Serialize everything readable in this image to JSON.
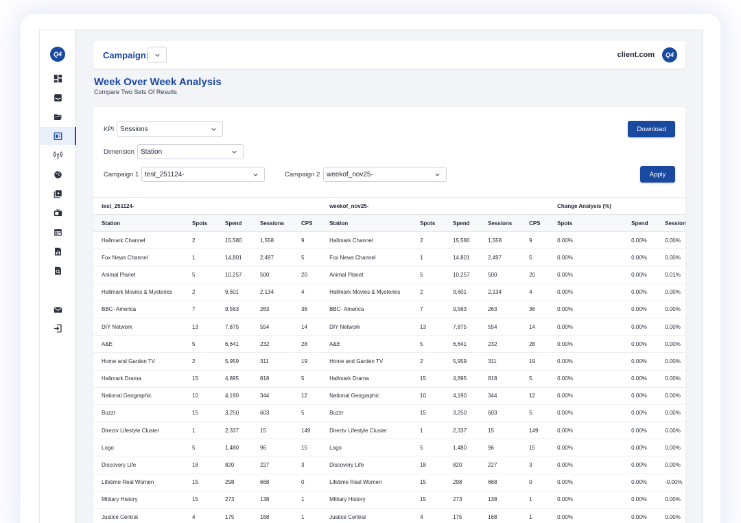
{
  "sidebar": {
    "logo": "Q4",
    "items": [
      {
        "icon": "dashboard-icon"
      },
      {
        "icon": "inbox-icon"
      },
      {
        "icon": "folder-open-icon"
      },
      {
        "icon": "newspaper-icon",
        "active": true
      },
      {
        "icon": "antenna-icon"
      },
      {
        "icon": "globe-icon"
      },
      {
        "icon": "video-library-icon"
      },
      {
        "icon": "tv-icon"
      },
      {
        "icon": "calendar-icon"
      },
      {
        "icon": "report-icon"
      },
      {
        "icon": "search-doc-icon"
      },
      {
        "icon": "mail-icon"
      },
      {
        "icon": "logout-icon"
      }
    ]
  },
  "header": {
    "campaign_label": "Campaign:",
    "client_name": "client.com",
    "client_avatar": "Q4"
  },
  "page": {
    "title": "Week Over Week Analysis",
    "subtitle": "Compare Two Sets Of Results"
  },
  "filters": {
    "kpi_label": "KPI",
    "kpi_value": "Sessions",
    "dimension_label": "Dimension",
    "dimension_value": "Station",
    "campaign1_label": "Campaign 1",
    "campaign1_value": "test_251124-",
    "campaign2_label": "Campaign 2",
    "campaign2_value": "weekof_nov25-",
    "download_label": "Download",
    "apply_label": "Apply"
  },
  "table": {
    "groups": [
      "test_251124-",
      "weekof_nov25-",
      "Change Analysis (%)"
    ],
    "headers": [
      "Station",
      "Spots",
      "Spend",
      "Sessions",
      "CPS",
      "Station",
      "Spots",
      "Spend",
      "Sessions",
      "CPS",
      "Spots",
      "Spend",
      "Sessions"
    ],
    "rows": [
      [
        "Hallmark Channel",
        "2",
        "15,580",
        "1,558",
        "9",
        "Hallmark Channel",
        "2",
        "15,580",
        "1,558",
        "9",
        "0.00%",
        "0.00%",
        "0.00%"
      ],
      [
        "Fox News Channel",
        "1",
        "14,801",
        "2,497",
        "5",
        "Fox News Channel",
        "1",
        "14,801",
        "2,497",
        "5",
        "0.00%",
        "0.00%",
        "0.00%"
      ],
      [
        "Animal Planet",
        "5",
        "10,257",
        "500",
        "20",
        "Animal Planet",
        "5",
        "10,257",
        "500",
        "20",
        "0.00%",
        "0.00%",
        "0.01%"
      ],
      [
        "Hallmark Movies & Mysteries",
        "2",
        "9,601",
        "2,134",
        "4",
        "Hallmark Movies & Mysteries",
        "2",
        "9,601",
        "2,134",
        "4",
        "0.00%",
        "0.00%",
        "0.00%"
      ],
      [
        "BBC- America",
        "7",
        "9,563",
        "263",
        "36",
        "BBC- America",
        "7",
        "9,563",
        "263",
        "36",
        "0.00%",
        "0.00%",
        "0.00%"
      ],
      [
        "DIY Network",
        "13",
        "7,875",
        "554",
        "14",
        "DIY Network",
        "13",
        "7,875",
        "554",
        "14",
        "0.00%",
        "0.00%",
        "0.00%"
      ],
      [
        "A&E",
        "5",
        "6,641",
        "232",
        "28",
        "A&E",
        "5",
        "6,641",
        "232",
        "28",
        "0.00%",
        "0.00%",
        "0.00%"
      ],
      [
        "Home and Garden TV",
        "2",
        "5,959",
        "311",
        "19",
        "Home and Garden TV",
        "2",
        "5,959",
        "311",
        "19",
        "0.00%",
        "0.00%",
        "0.00%"
      ],
      [
        "Hallmark Drama",
        "15",
        "4,895",
        "818",
        "5",
        "Hallmark Drama",
        "15",
        "4,895",
        "818",
        "5",
        "0.00%",
        "0.00%",
        "0.00%"
      ],
      [
        "National Geographic",
        "10",
        "4,190",
        "344",
        "12",
        "National Geographic",
        "10",
        "4,190",
        "344",
        "12",
        "0.00%",
        "0.00%",
        "0.00%"
      ],
      [
        "Buzzr",
        "15",
        "3,250",
        "603",
        "5",
        "Buzzr",
        "15",
        "3,250",
        "603",
        "5",
        "0.00%",
        "0.00%",
        "0.00%"
      ],
      [
        "Directv Lifestyle Cluster",
        "1",
        "2,337",
        "15",
        "149",
        "Directv Lifestyle Cluster",
        "1",
        "2,337",
        "15",
        "149",
        "0.00%",
        "0.00%",
        "0.00%"
      ],
      [
        "Logo",
        "5",
        "1,480",
        "96",
        "15",
        "Logo",
        "5",
        "1,480",
        "96",
        "15",
        "0.00%",
        "0.00%",
        "0.00%"
      ],
      [
        "Discovery Life",
        "18",
        "820",
        "227",
        "3",
        "Discovery Life",
        "18",
        "820",
        "227",
        "3",
        "0.00%",
        "0.00%",
        "0.00%"
      ],
      [
        "Lifetime Real Women",
        "15",
        "298",
        "668",
        "0",
        "Lifetime Real Women",
        "15",
        "298",
        "668",
        "0",
        "0.00%",
        "0.00%",
        "-0.00%"
      ],
      [
        "Military History",
        "15",
        "273",
        "138",
        "1",
        "Military History",
        "15",
        "273",
        "138",
        "1",
        "0.00%",
        "0.00%",
        "0.00%"
      ],
      [
        "Justice Central",
        "4",
        "175",
        "168",
        "1",
        "Justice Central",
        "4",
        "175",
        "168",
        "1",
        "0.00%",
        "0.00%",
        "0.00%"
      ]
    ]
  },
  "colors": {
    "brand": "#1a4aa0",
    "background": "#f3f4f8"
  }
}
